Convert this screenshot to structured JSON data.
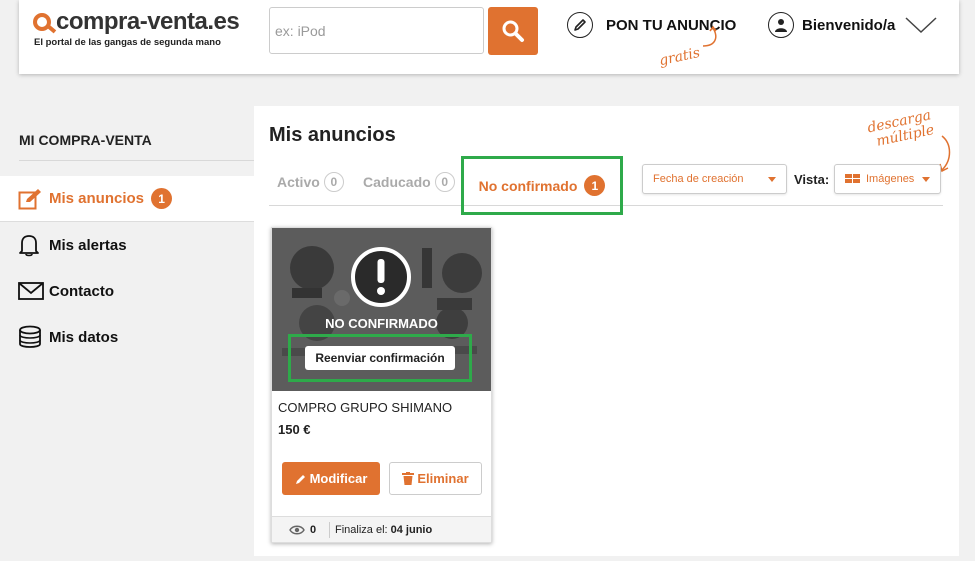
{
  "header": {
    "logo_text": "compra-venta.es",
    "logo_tagline": "El portal de las gangas de segunda mano",
    "search_placeholder": "ex: iPod",
    "post_ad_label": "PON TU ANUNCIO",
    "gratis_note": "gratis",
    "welcome_label": "Bienvenido/a"
  },
  "sidebar": {
    "title": "MI COMPRA-VENTA",
    "items": [
      {
        "label": "Mis anuncios",
        "icon": "edit-icon",
        "badge": "1",
        "active": true
      },
      {
        "label": "Mis alertas",
        "icon": "bell-icon"
      },
      {
        "label": "Contacto",
        "icon": "envelope-icon"
      },
      {
        "label": "Mis datos",
        "icon": "database-icon"
      }
    ]
  },
  "main": {
    "title": "Mis anuncios",
    "descarga_note_1": "descarga",
    "descarga_note_2": "múltiple",
    "tabs": [
      {
        "label": "Activo",
        "count": "0"
      },
      {
        "label": "Caducado",
        "count": "0"
      },
      {
        "label": "No confirmado",
        "count": "1"
      }
    ],
    "sort_select": "Fecha de creación",
    "vista_label": "Vista:",
    "view_select": "Imágenes"
  },
  "card": {
    "status": "NO CONFIRMADO",
    "resend_label": "Reenviar confirmación",
    "title": "COMPRO GRUPO SHIMANO",
    "price": "150 €",
    "modify_label": "Modificar",
    "delete_label": "Eliminar",
    "views": "0",
    "ends_prefix": "Finaliza el:",
    "ends_date": "04 junio"
  },
  "colors": {
    "accent": "#e07230",
    "highlight_green": "#2eaa4a"
  }
}
